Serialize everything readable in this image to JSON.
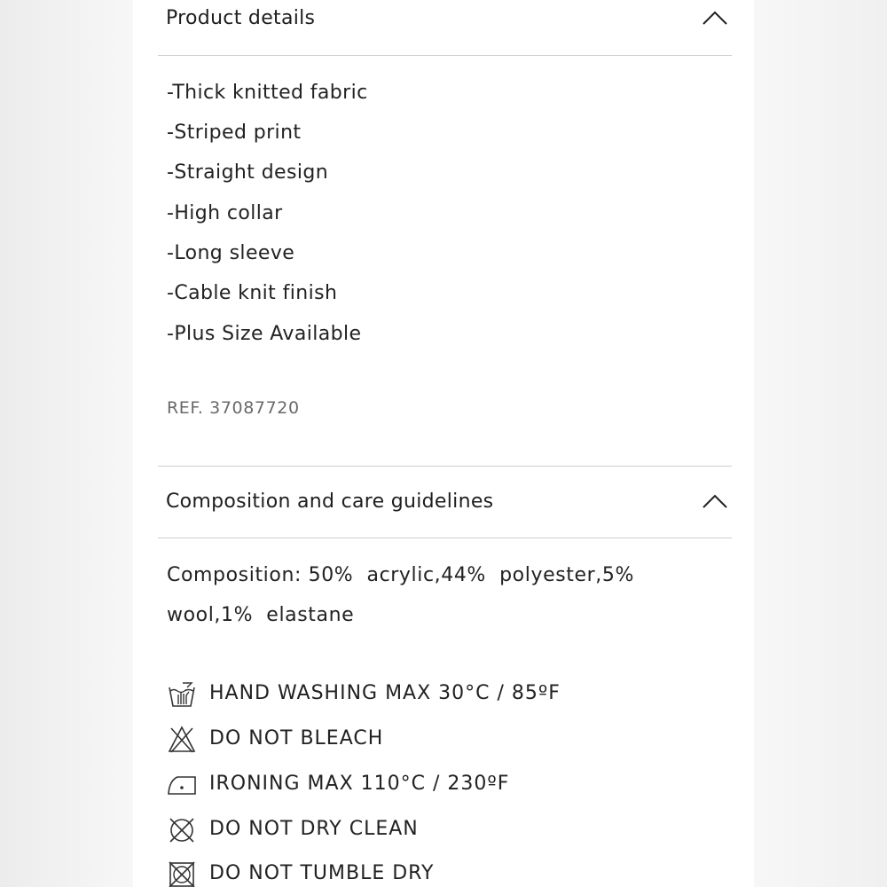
{
  "product_details": {
    "title": "Product details",
    "items": [
      "-Thick knitted fabric",
      "-Striped print",
      "-Straight design",
      "-High collar",
      "-Long sleeve",
      "-Cable knit finish",
      "-Plus Size Available"
    ],
    "ref": "REF. 37087720",
    "expanded_icon": "chevron-up-icon"
  },
  "composition": {
    "title": "Composition and care guidelines",
    "lines": [
      "Composition: 50%  acrylic,44%  polyester,5%",
      "wool,1%  elastane"
    ],
    "expanded_icon": "chevron-up-icon",
    "care": [
      {
        "icon": "hand-wash-icon",
        "text": "HAND WASHING MAX 30°C / 85ºF"
      },
      {
        "icon": "no-bleach-icon",
        "text": "DO NOT BLEACH"
      },
      {
        "icon": "iron-icon",
        "text": "IRONING MAX 110°C / 230ºF"
      },
      {
        "icon": "no-dry-clean-icon",
        "text": "DO NOT DRY CLEAN"
      },
      {
        "icon": "no-tumble-dry-icon",
        "text": "DO NOT TUMBLE DRY"
      }
    ]
  },
  "colors": {
    "background": "#ffffff",
    "text": "#222222",
    "muted_text": "#6a6a6a",
    "divider": "#cfcfcf"
  }
}
